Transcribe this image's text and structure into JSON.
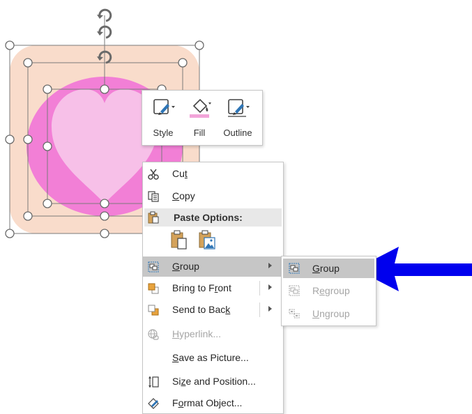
{
  "mini_toolbar": {
    "style_label": "Style",
    "fill_label": "Fill",
    "outline_label": "Outline"
  },
  "context_menu": {
    "cut": {
      "pre": "Cu",
      "key": "t",
      "post": ""
    },
    "copy": {
      "pre": "",
      "key": "C",
      "post": "opy"
    },
    "paste_options_label": "Paste Options:",
    "group": {
      "pre": "",
      "key": "G",
      "post": "roup"
    },
    "bring_to_front": {
      "pre": "Bring to F",
      "key": "r",
      "post": "ont"
    },
    "send_to_back": {
      "pre": "Send to Bac",
      "key": "k",
      "post": ""
    },
    "hyperlink": {
      "pre": "",
      "key": "H",
      "post": "yperlink..."
    },
    "save_as_picture": {
      "pre": "",
      "key": "S",
      "post": "ave as Picture..."
    },
    "size_and_position": {
      "pre": "Si",
      "key": "z",
      "post": "e and Position..."
    },
    "format_object": {
      "pre": "F",
      "key": "o",
      "post": "rmat Object..."
    }
  },
  "group_submenu": {
    "group": {
      "pre": "",
      "key": "G",
      "post": "roup"
    },
    "regroup": {
      "pre": "R",
      "key": "e",
      "post": "group"
    },
    "ungroup": {
      "pre": "",
      "key": "U",
      "post": "ngroup"
    }
  },
  "colors": {
    "outer_shape": "#f9dccb",
    "circle": "#f27fd6",
    "heart": "#f7c0e8",
    "hover": "#c6c6c6",
    "arrow": "#0000ee",
    "fill_bar": "#f2a4d9"
  }
}
